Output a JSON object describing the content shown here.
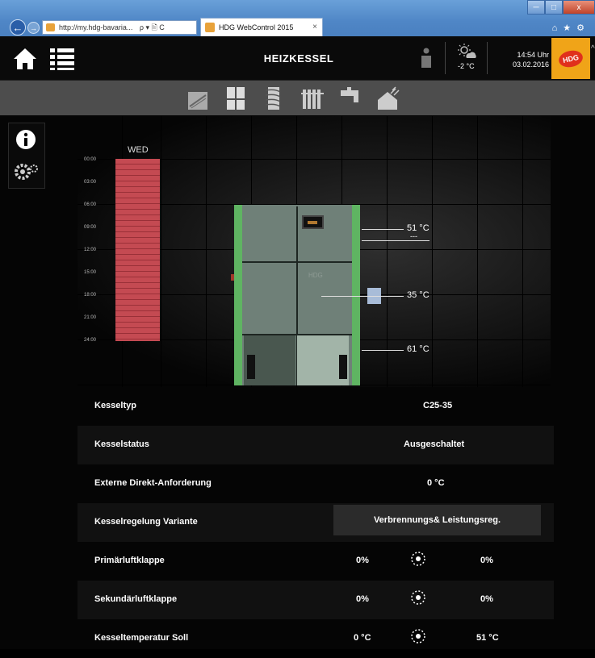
{
  "browser": {
    "url": "http://my.hdg-bavaria...",
    "search_symbols": "ρ ▾ 🖹 C",
    "tab_title": "HDG WebControl 2015",
    "tab_close": "×",
    "back_label": "←",
    "forward_label": "→",
    "win_min": "─",
    "win_max": "□",
    "win_close": "x",
    "toolbar_icons": "⌂★⚙"
  },
  "header": {
    "title": "HEIZKESSEL",
    "outside_temp": "-2 °C",
    "time": "14:54 Uhr",
    "date": "03.02.2016",
    "logo_text": "HDG"
  },
  "toolbar_icons": [
    "solar-panel-icon",
    "fridge-icon",
    "buffer-tank-icon",
    "radiator-icon",
    "tap-icon",
    "house-solar-icon"
  ],
  "schedule": {
    "day": "WED",
    "hours": [
      "00:00",
      "03:00",
      "06:00",
      "09:00",
      "12:00",
      "15:00",
      "18:00",
      "21:00",
      "24:00"
    ]
  },
  "boiler": {
    "brand": "HDG",
    "temp_top": "51 °C",
    "temp_top_sub": "---",
    "temp_mid": "35 °C",
    "temp_bottom": "61 °C"
  },
  "rows": [
    {
      "label": "Kesseltyp",
      "value": "C25-35"
    },
    {
      "label": "Kesselstatus",
      "value": "Ausgeschaltet"
    },
    {
      "label": "Externe Direkt-Anforderung",
      "value": "0 °C"
    },
    {
      "label": "Kesselregelung Variante",
      "value": "Verbrennungs& Leistungsreg."
    },
    {
      "label": "Primärluftklappe",
      "value": "0%",
      "value2": "0%"
    },
    {
      "label": "Sekundärluftklappe",
      "value": "0%",
      "value2": "0%"
    },
    {
      "label": "Kesseltemperatur Soll",
      "value": "0 °C",
      "value2": "51 °C"
    }
  ],
  "colors": {
    "accent_orange": "#f0a418",
    "boiler_green": "#5fb462",
    "schedule_red": "#c44a52"
  }
}
